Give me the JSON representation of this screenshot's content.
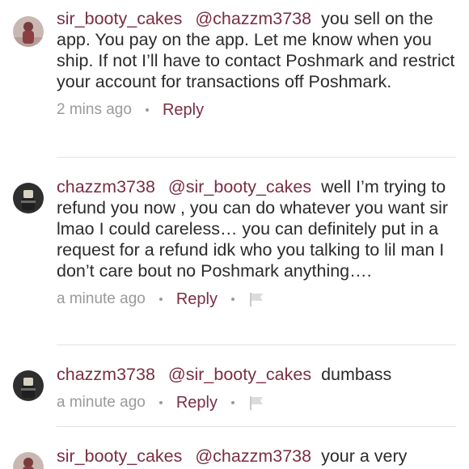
{
  "comments": [
    {
      "username": "sir_booty_cakes",
      "mention": "@chazzm3738",
      "message": "you sell on the app. You pay on the app. Let me know when you ship. If not I’ll have to contact Poshmark and restrict your account for transactions off Poshmark.",
      "time": "2 mins ago",
      "reply_label": "Reply"
    },
    {
      "username": "chazzm3738",
      "mention": "@sir_booty_cakes",
      "message": "well I’m trying to refund you now , you can do whatever you want sir lmao I could careless… you can definitely put in a request for a refund idk who you talking to lil man I don’t care bout no Poshmark anything….",
      "time": "a minute ago",
      "reply_label": "Reply"
    },
    {
      "username": "chazzm3738",
      "mention": "@sir_booty_cakes",
      "message": "dumbass",
      "time": "a minute ago",
      "reply_label": "Reply"
    },
    {
      "username": "sir_booty_cakes",
      "mention": "@chazzm3738",
      "message": "your a very",
      "time": "",
      "reply_label": ""
    }
  ],
  "colors": {
    "username": "#7a2e43",
    "text": "#2b2b2b",
    "meta": "#9a9a9a",
    "divider": "#e2e2e2"
  },
  "icons": {
    "flag": "flag-icon",
    "separator": "dot-separator"
  }
}
